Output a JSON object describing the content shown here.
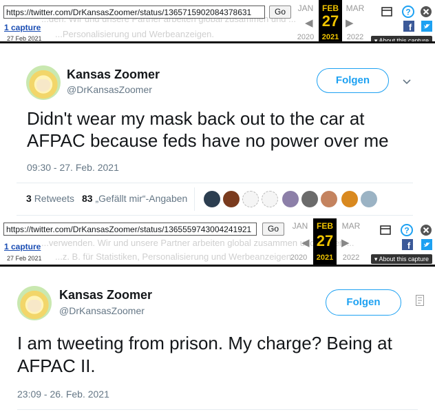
{
  "bar1": {
    "url": "https://twitter.com/DrKansasZoomer/status/1365715902084378631",
    "go_label": "Go",
    "capture_label": "1 capture",
    "capture_date": "27 Feb 2021",
    "prev_month": "JAN",
    "cur_month": "FEB",
    "next_month": "MAR",
    "day": "27",
    "prev_year": "2020",
    "cur_year": "2021",
    "next_year": "2022",
    "about_label": "About this capture",
    "ghost_text_1": "...den. Wir und unsere Partner arbeiten global zusammen und ...",
    "ghost_text_2": "...Personalisierung und Werbeanzeigen."
  },
  "tweet1": {
    "name": "Kansas Zoomer",
    "handle": "@DrKansasZoomer",
    "follow_label": "Folgen",
    "text": "Didn't wear my mask back out to the car at AFPAC because feds have no power over me",
    "timestamp": "09:30 - 27. Feb. 2021",
    "retweets_count": "3",
    "retweets_label": "Retweets",
    "likes_count": "83",
    "likes_label": "„Gefällt mir“-Angaben"
  },
  "bar2": {
    "url": "https://twitter.com/DrKansasZoomer/status/1365559743004241921",
    "go_label": "Go",
    "capture_label": "1 capture",
    "capture_date": "27 Feb 2021",
    "prev_month": "JAN",
    "cur_month": "FEB",
    "next_month": "MAR",
    "day": "27",
    "prev_year": "2020",
    "cur_year": "2021",
    "next_year": "2022",
    "about_label": "About this capture",
    "ghost_text_1": "...verwenden. Wir und unsere Partner arbeiten global zusammen und nutzen ...",
    "ghost_text_2": "...z. B. für Statistiken, Personalisierung und Werbeanzeigen."
  },
  "tweet2": {
    "name": "Kansas Zoomer",
    "handle": "@DrKansasZoomer",
    "follow_label": "Folgen",
    "text": "I am tweeting from prison. My charge? Being at AFPAC II.",
    "timestamp": "23:09 - 26. Feb. 2021"
  },
  "colors": {
    "accent": "#1da1f2",
    "wayback_gold": "#f0c400",
    "link_blue": "#1a4db3"
  }
}
